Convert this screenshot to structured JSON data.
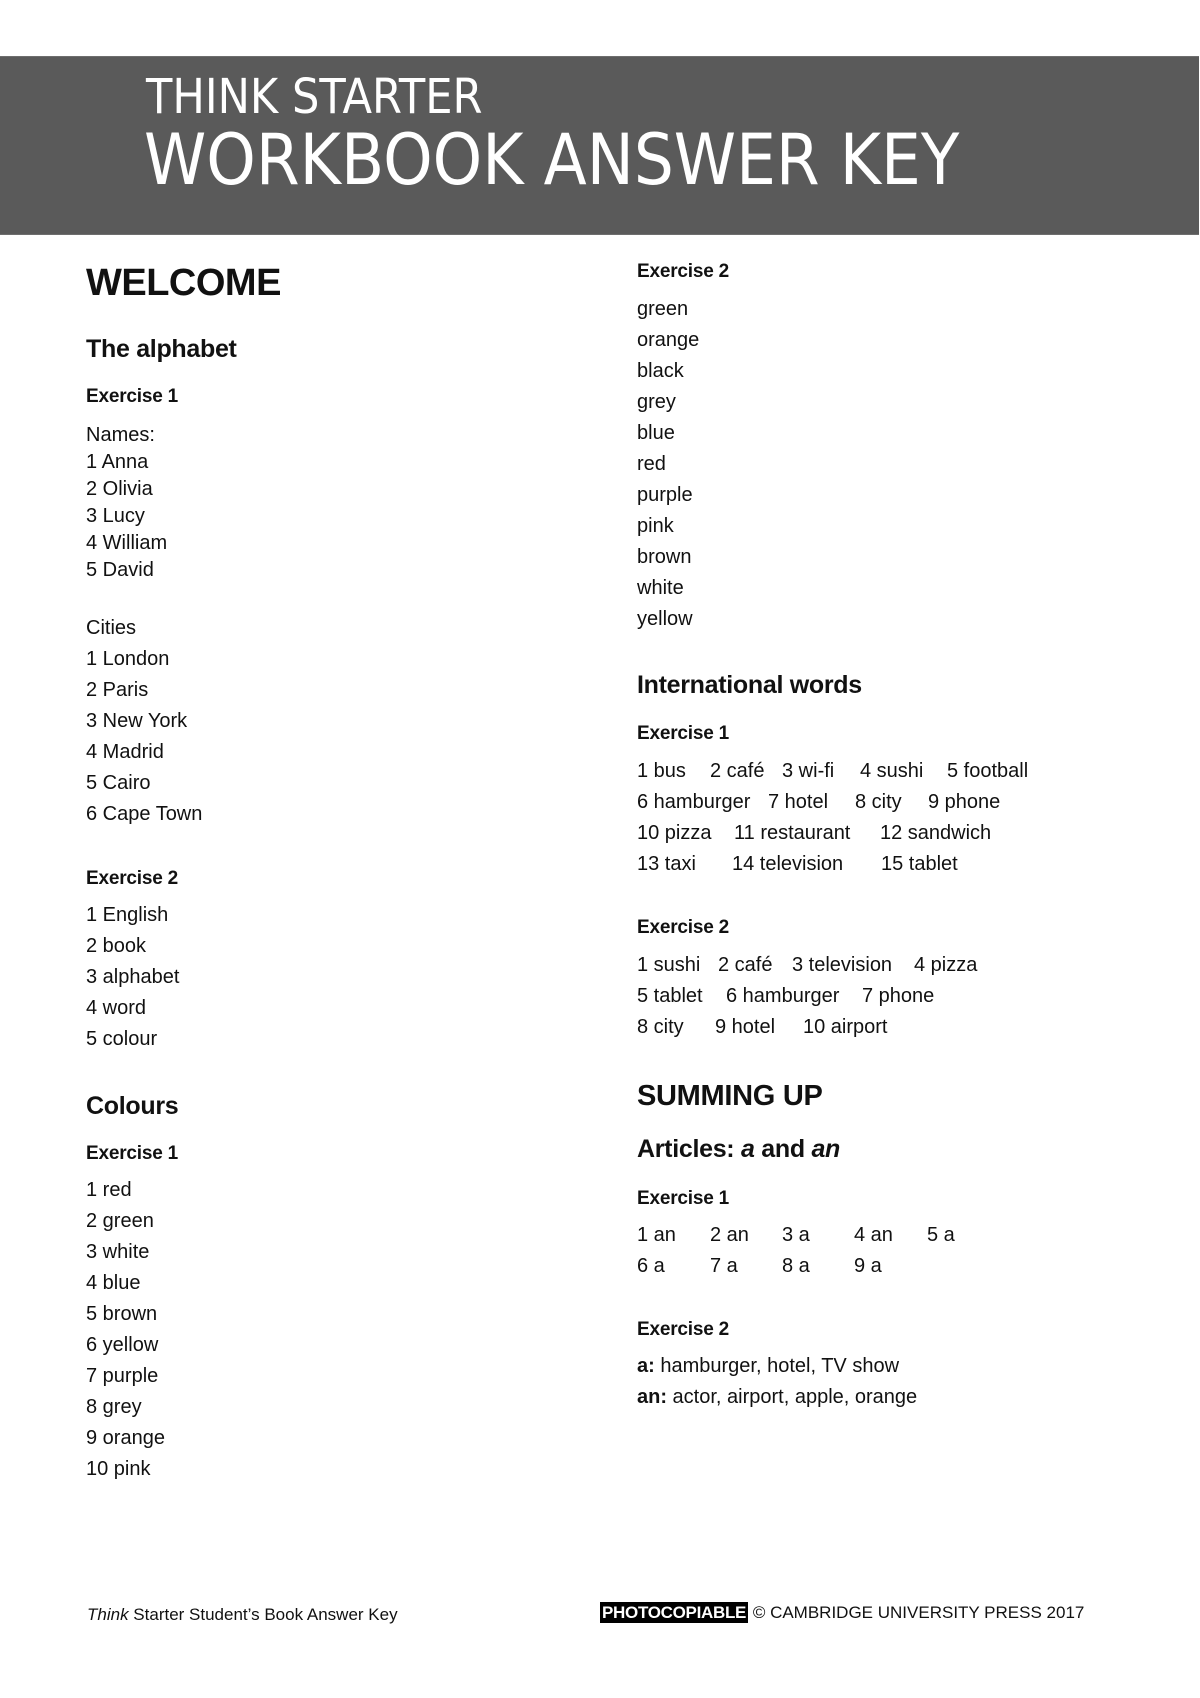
{
  "header": {
    "subtitle": "THINK STARTER",
    "title": "WORKBOOK ANSWER KEY",
    "band_color": "#5a5a5a"
  },
  "left_column": {
    "unit_title": "WELCOME",
    "alphabet": {
      "title": "The alphabet",
      "exercise1": {
        "label": "Exercise 1",
        "names_label": "Names:",
        "names": [
          "1 Anna",
          "2 Olivia",
          "3 Lucy",
          "4 William",
          "5 David"
        ],
        "cities_label": "Cities",
        "cities": [
          "1 London",
          "2 Paris",
          "3 New York",
          "4 Madrid",
          "5 Cairo",
          "6 Cape Town"
        ]
      },
      "exercise2": {
        "label": "Exercise 2",
        "answers": [
          "1 English",
          "2 book",
          "3 alphabet",
          "4 word",
          "5 colour"
        ]
      }
    },
    "colours": {
      "title": "Colours",
      "exercise1": {
        "label": "Exercise 1",
        "answers": [
          "1 red",
          "2 green",
          "3 white",
          "4 blue",
          "5 brown",
          "6 yellow",
          "7 purple",
          "8 grey",
          "9 orange",
          "10 pink"
        ]
      }
    }
  },
  "right_column": {
    "colours_exercise2": {
      "label": "Exercise 2",
      "answers": [
        "green",
        "orange",
        "black",
        "grey",
        "blue",
        "red",
        "purple",
        "pink",
        "brown",
        "white",
        "yellow"
      ]
    },
    "international_words": {
      "title": "International words",
      "exercise1": {
        "label": "Exercise 1",
        "rows": [
          [
            "1 bus",
            "2 café",
            "3 wi-fi",
            "4 sushi",
            "5 football"
          ],
          [
            "6 hamburger",
            "7 hotel",
            "8 city",
            "9 phone"
          ],
          [
            "10 pizza",
            "11 restaurant",
            "12 sandwich"
          ],
          [
            "13 taxi",
            "14 television",
            "15 tablet"
          ]
        ]
      },
      "exercise2": {
        "label": "Exercise 2",
        "rows": [
          [
            "1 sushi",
            "2 café",
            "3 television",
            "4 pizza"
          ],
          [
            "5 tablet",
            "6 hamburger",
            "7 phone"
          ],
          [
            "8 city",
            "9 hotel",
            "10 airport"
          ]
        ]
      }
    },
    "summing_up": {
      "title": "SUMMING UP",
      "articles": {
        "title_prefix": "Articles: ",
        "title_a": "a",
        "title_and": " and ",
        "title_an": "an",
        "exercise1": {
          "label": "Exercise 1",
          "rows": [
            [
              "1 an",
              "2 an",
              "3 a",
              "4 an",
              "5 a"
            ],
            [
              "6 a",
              "7 a",
              "8 a",
              "9 a"
            ]
          ]
        },
        "exercise2": {
          "label": "Exercise 2",
          "a_label": "a:",
          "a_words": " hamburger, hotel, TV show",
          "an_label": "an:",
          "an_words": " actor, airport, apple, orange"
        }
      }
    }
  },
  "footer": {
    "left_italic": "Think",
    "left_text": " Starter Student’s Book Answer Key",
    "badge": "PHOTOCOPIABLE",
    "right_text": " © CAMBRIDGE UNIVERSITY PRESS 2017"
  }
}
